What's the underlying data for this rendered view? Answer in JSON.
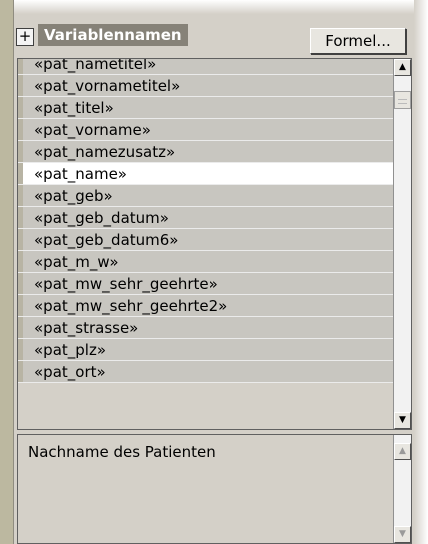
{
  "header": {
    "expand_symbol": "+",
    "title": "Variablennamen",
    "formula_button": "Formel..."
  },
  "variable_list": {
    "items": [
      {
        "label": "«pat_nametitel»",
        "selected": false
      },
      {
        "label": "«pat_vornametitel»",
        "selected": false
      },
      {
        "label": "«pat_titel»",
        "selected": false
      },
      {
        "label": "«pat_vorname»",
        "selected": false
      },
      {
        "label": "«pat_namezusatz»",
        "selected": false
      },
      {
        "label": "«pat_name»",
        "selected": true
      },
      {
        "label": "«pat_geb»",
        "selected": false
      },
      {
        "label": "«pat_geb_datum»",
        "selected": false
      },
      {
        "label": "«pat_geb_datum6»",
        "selected": false
      },
      {
        "label": "«pat_m_w»",
        "selected": false
      },
      {
        "label": "«pat_mw_sehr_geehrte»",
        "selected": false
      },
      {
        "label": "«pat_mw_sehr_geehrte2»",
        "selected": false
      },
      {
        "label": "«pat_strasse»",
        "selected": false
      },
      {
        "label": "«pat_plz»",
        "selected": false
      },
      {
        "label": "«pat_ort»",
        "selected": false
      }
    ],
    "scroll_up_icon": "triangle-up-icon",
    "scroll_down_icon": "triangle-down-icon"
  },
  "description": {
    "text": "Nachname des Patienten"
  },
  "colors": {
    "panel": "#d4d0c8",
    "header_label_bg": "#868278",
    "item_bg": "#c8c6c0",
    "selected_bg": "#ffffff"
  }
}
